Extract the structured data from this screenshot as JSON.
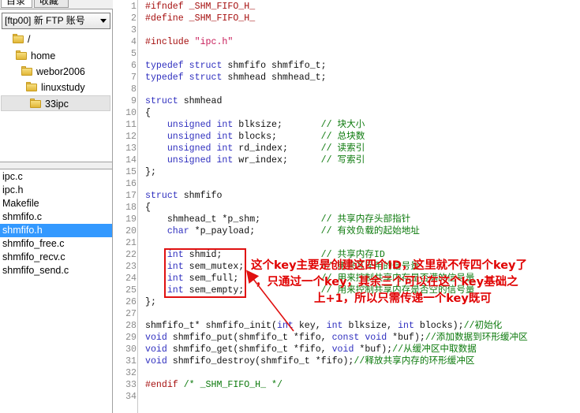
{
  "left_panel": {
    "tabs": [
      "目录",
      "收藏"
    ],
    "site_select": "[ftp00] 新 FTP 账号",
    "tree": [
      {
        "label": "/",
        "depth": 0
      },
      {
        "label": "home",
        "depth": 1
      },
      {
        "label": "webor2006",
        "depth": 2
      },
      {
        "label": "linuxstudy",
        "depth": 3
      },
      {
        "label": "33ipc",
        "depth": 4,
        "selected": true
      }
    ],
    "files": [
      {
        "name": "ipc.c"
      },
      {
        "name": "ipc.h"
      },
      {
        "name": "Makefile"
      },
      {
        "name": "shmfifo.c"
      },
      {
        "name": "shmfifo.h",
        "selected": true
      },
      {
        "name": "shmfifo_free.c"
      },
      {
        "name": "shmfifo_recv.c"
      },
      {
        "name": "shmfifo_send.c"
      }
    ],
    "selection_color": "#3399ff",
    "folder_icon": "folder-icon"
  },
  "editor": {
    "lines": [
      {
        "n": "1",
        "segs": [
          [
            "pp",
            "#ifndef _SHM_FIFO_H_"
          ]
        ]
      },
      {
        "n": "2",
        "segs": [
          [
            "pp",
            "#define _SHM_FIFO_H_"
          ]
        ]
      },
      {
        "n": "3",
        "segs": []
      },
      {
        "n": "4",
        "segs": [
          [
            "pp",
            "#include "
          ],
          [
            "st",
            "\"ipc.h\""
          ]
        ]
      },
      {
        "n": "5",
        "segs": []
      },
      {
        "n": "6",
        "segs": [
          [
            "kw",
            "typedef struct"
          ],
          [
            "tx",
            " shmfifo shmfifo_t;"
          ]
        ]
      },
      {
        "n": "7",
        "segs": [
          [
            "kw",
            "typedef struct"
          ],
          [
            "tx",
            " shmhead shmhead_t;"
          ]
        ]
      },
      {
        "n": "8",
        "segs": []
      },
      {
        "n": "9",
        "segs": [
          [
            "kw",
            "struct"
          ],
          [
            "tx",
            " shmhead"
          ]
        ]
      },
      {
        "n": "10",
        "segs": [
          [
            "tx",
            "{"
          ]
        ]
      },
      {
        "n": "11",
        "segs": [
          [
            "tx",
            "    "
          ],
          [
            "kw",
            "unsigned int"
          ],
          [
            "tx",
            " blksize;       "
          ],
          [
            "cm",
            "// 块大小"
          ]
        ]
      },
      {
        "n": "12",
        "segs": [
          [
            "tx",
            "    "
          ],
          [
            "kw",
            "unsigned int"
          ],
          [
            "tx",
            " blocks;        "
          ],
          [
            "cm",
            "// 总块数"
          ]
        ]
      },
      {
        "n": "13",
        "segs": [
          [
            "tx",
            "    "
          ],
          [
            "kw",
            "unsigned int"
          ],
          [
            "tx",
            " rd_index;      "
          ],
          [
            "cm",
            "// 读索引"
          ]
        ]
      },
      {
        "n": "14",
        "segs": [
          [
            "tx",
            "    "
          ],
          [
            "kw",
            "unsigned int"
          ],
          [
            "tx",
            " wr_index;      "
          ],
          [
            "cm",
            "// 写索引"
          ]
        ]
      },
      {
        "n": "15",
        "segs": [
          [
            "tx",
            "};"
          ]
        ]
      },
      {
        "n": "16",
        "segs": []
      },
      {
        "n": "17",
        "segs": [
          [
            "kw",
            "struct"
          ],
          [
            "tx",
            " shmfifo"
          ]
        ]
      },
      {
        "n": "18",
        "segs": [
          [
            "tx",
            "{"
          ]
        ]
      },
      {
        "n": "19",
        "segs": [
          [
            "tx",
            "    shmhead_t *p_shm;           "
          ],
          [
            "cm",
            "// 共享内存头部指针"
          ]
        ]
      },
      {
        "n": "20",
        "segs": [
          [
            "tx",
            "    "
          ],
          [
            "kw",
            "char"
          ],
          [
            "tx",
            " *p_payload;            "
          ],
          [
            "cm",
            "// 有效负载的起始地址"
          ]
        ]
      },
      {
        "n": "21",
        "segs": []
      },
      {
        "n": "22",
        "segs": [
          [
            "tx",
            "    "
          ],
          [
            "kw",
            "int"
          ],
          [
            "tx",
            " shmid;                  "
          ],
          [
            "cm",
            "// 共享内存ID"
          ]
        ]
      },
      {
        "n": "23",
        "segs": [
          [
            "tx",
            "    "
          ],
          [
            "kw",
            "int"
          ],
          [
            "tx",
            " sem_mutex;              "
          ],
          [
            "cm",
            "// 用来互斥用的信号量"
          ]
        ]
      },
      {
        "n": "24",
        "segs": [
          [
            "tx",
            "    "
          ],
          [
            "kw",
            "int"
          ],
          [
            "tx",
            " sem_full;               "
          ],
          [
            "cm",
            "// 用来控制共享内存是否满的信号量"
          ]
        ]
      },
      {
        "n": "25",
        "segs": [
          [
            "tx",
            "    "
          ],
          [
            "kw",
            "int"
          ],
          [
            "tx",
            " sem_empty;              "
          ],
          [
            "cm",
            "// 用来控制共享内存是否空的信号量"
          ]
        ]
      },
      {
        "n": "26",
        "segs": [
          [
            "tx",
            "};"
          ]
        ]
      },
      {
        "n": "27",
        "segs": []
      },
      {
        "n": "28",
        "segs": [
          [
            "tx",
            "shmfifo_t* shmfifo_init("
          ],
          [
            "kw",
            "int"
          ],
          [
            "tx",
            " key, "
          ],
          [
            "kw",
            "int"
          ],
          [
            "tx",
            " blksize, "
          ],
          [
            "kw",
            "int"
          ],
          [
            "tx",
            " blocks);"
          ],
          [
            "cm",
            "//初始化"
          ]
        ]
      },
      {
        "n": "29",
        "segs": [
          [
            "kw",
            "void"
          ],
          [
            "tx",
            " shmfifo_put(shmfifo_t *fifo, "
          ],
          [
            "kw",
            "const void"
          ],
          [
            "tx",
            " *buf);"
          ],
          [
            "cm",
            "//添加数据到环形缓冲区"
          ]
        ]
      },
      {
        "n": "30",
        "segs": [
          [
            "kw",
            "void"
          ],
          [
            "tx",
            " shmfifo_get(shmfifo_t *fifo, "
          ],
          [
            "kw",
            "void"
          ],
          [
            "tx",
            " *buf);"
          ],
          [
            "cm",
            "//从缓冲区中取数据"
          ]
        ]
      },
      {
        "n": "31",
        "segs": [
          [
            "kw",
            "void"
          ],
          [
            "tx",
            " shmfifo_destroy(shmfifo_t *fifo);"
          ],
          [
            "cm",
            "//释放共享内存的环形缓冲区"
          ]
        ]
      },
      {
        "n": "32",
        "segs": []
      },
      {
        "n": "33",
        "segs": [
          [
            "pp",
            "#endif"
          ],
          [
            "tx",
            " "
          ],
          [
            "cm",
            "/* _SHM_FIFO_H_ */"
          ]
        ]
      },
      {
        "n": "34",
        "segs": []
      }
    ],
    "colors": {
      "preprocessor": "#a61010",
      "keyword": "#2f2fbf",
      "string": "#c81e5a",
      "comment": "#0d7a0d",
      "line_number": "#8a8a8a"
    }
  },
  "annotation": {
    "lines": [
      "这个key主要是创建这四个ID，这里就不传四个key了",
      "，只通过一个key，其余三个可以在这个key基础之",
      "上+1，所以只需传递一个key既可"
    ],
    "color": "#e00000"
  }
}
